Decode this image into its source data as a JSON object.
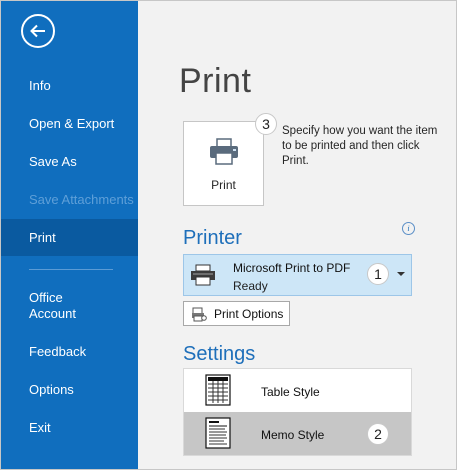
{
  "sidebar": {
    "back_icon": "arrow-left-circle-icon",
    "items": [
      {
        "label": "Info",
        "state": "normal"
      },
      {
        "label": "Open & Export",
        "state": "normal"
      },
      {
        "label": "Save As",
        "state": "normal"
      },
      {
        "label": "Save Attachments",
        "state": "disabled"
      },
      {
        "label": "Print",
        "state": "active"
      },
      {
        "label": "Office\nAccount",
        "state": "normal"
      },
      {
        "label": "Feedback",
        "state": "normal"
      },
      {
        "label": "Options",
        "state": "normal"
      },
      {
        "label": "Exit",
        "state": "normal"
      }
    ],
    "colors": {
      "background": "#106ebe",
      "active": "#0a5aa0",
      "disabled_text": "#5e9fd8"
    }
  },
  "main": {
    "title": "Print",
    "print_button": {
      "label": "Print",
      "icon": "printer-icon"
    },
    "hint": "Specify how you want the item to be printed and then click Print.",
    "printer_section": {
      "title": "Printer",
      "info_icon": "info-icon",
      "selected_printer": {
        "name": "Microsoft Print to PDF",
        "status": "Ready"
      },
      "print_options_label": "Print Options"
    },
    "settings_section": {
      "title": "Settings",
      "styles": [
        {
          "label": "Table Style",
          "selected": false
        },
        {
          "label": "Memo Style",
          "selected": true
        }
      ]
    }
  },
  "callouts": {
    "one": "1",
    "two": "2",
    "three": "3"
  },
  "colors": {
    "accent": "#1e6fba",
    "selected_printer_bg": "#cde6f7",
    "selected_style_bg": "#c6c6c6"
  }
}
